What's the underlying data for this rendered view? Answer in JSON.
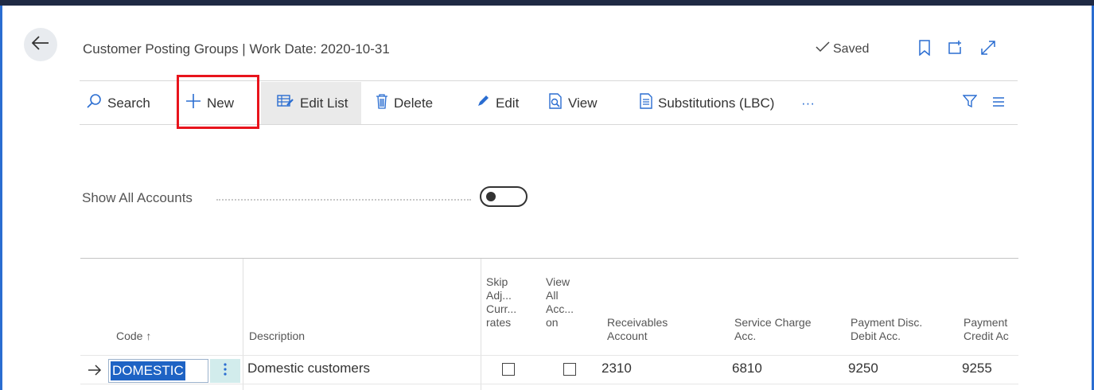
{
  "header": {
    "title": "Customer Posting Groups | Work Date: 2020-10-31",
    "saved_label": "Saved"
  },
  "toolbar": {
    "search": "Search",
    "new": "New",
    "edit_list": "Edit List",
    "delete": "Delete",
    "edit": "Edit",
    "view": "View",
    "substitutions": "Substitutions (LBC)",
    "more": "···"
  },
  "filter": {
    "show_all_label": "Show All Accounts",
    "show_all_value": false
  },
  "table": {
    "columns": {
      "code": "Code ↑",
      "description": "Description",
      "skip_adj_1": "Skip",
      "skip_adj_2": "Adj...",
      "skip_adj_3": "Curr...",
      "skip_adj_4": "rates",
      "view_all_1": "View",
      "view_all_2": "All",
      "view_all_3": "Acc...",
      "view_all_4": "on",
      "receivables_1": "Receivables",
      "receivables_2": "Account",
      "service_charge_1": "Service Charge",
      "service_charge_2": "Acc.",
      "payment_disc_debit_1": "Payment Disc.",
      "payment_disc_debit_2": "Debit Acc.",
      "payment_disc_credit_1": "Payment",
      "payment_disc_credit_2": "Credit Ac"
    },
    "rows": [
      {
        "code": "DOMESTIC",
        "description": "Domestic customers",
        "skip_adj_currency_rates": false,
        "view_all_accounts_on_lookup": false,
        "receivables_account": "2310",
        "service_charge_acc": "6810",
        "payment_disc_debit_acc": "9250",
        "payment_disc_credit_acc": "9255"
      }
    ]
  },
  "colors": {
    "accent_blue": "#1e63c4",
    "highlight_red": "#e8141c",
    "frame_blue": "#2a6dd1"
  }
}
